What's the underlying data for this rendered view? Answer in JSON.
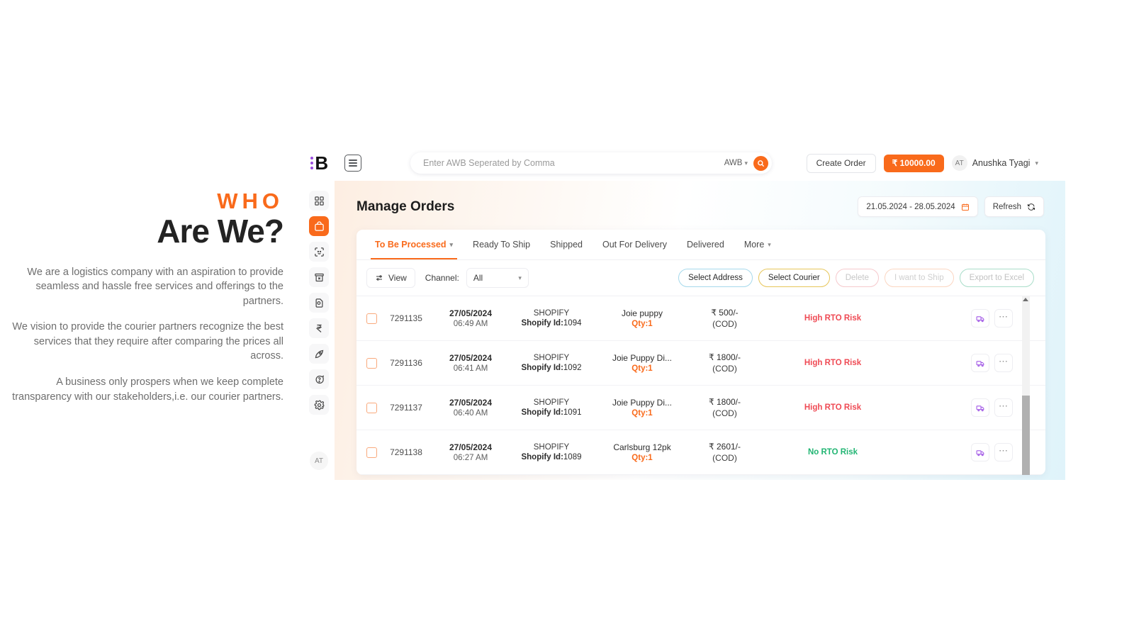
{
  "marketing": {
    "eyebrow": "WHO",
    "heading": "Are We?",
    "paragraphs": [
      "We are a logistics company with an aspiration to provide seamless and hassle free services and offerings to the partners.",
      "We vision to provide the courier partners recognize the best services that they require after comparing the prices all across.",
      "A business only prospers when we keep complete transparency with our stakeholders,i.e. our courier partners."
    ],
    "accent_color": "#f96a1b"
  },
  "topbar": {
    "logo_letter": "B",
    "menu_icon": "hamburger-icon",
    "search": {
      "placeholder": "Enter AWB Seperated by Comma",
      "value": "",
      "filter_label": "AWB",
      "submit_icon": "search-icon"
    },
    "create_order_label": "Create Order",
    "wallet_label": "₹ 10000.00",
    "wallet_color": "#f96a1b",
    "user": {
      "initials": "AT",
      "name": "Anushka Tyagi"
    }
  },
  "sidebar": {
    "items": [
      {
        "name": "dashboard",
        "icon": "grid-icon",
        "active": false
      },
      {
        "name": "orders",
        "icon": "bag-icon",
        "active": true
      },
      {
        "name": "ndr",
        "icon": "face-scan-icon",
        "active": false
      },
      {
        "name": "returns",
        "icon": "archive-box-x-icon",
        "active": false
      },
      {
        "name": "shipments",
        "icon": "document-box-icon",
        "active": false
      },
      {
        "name": "billing",
        "icon": "rupee-icon",
        "active": false
      },
      {
        "name": "tools",
        "icon": "pen-nib-icon",
        "active": false
      },
      {
        "name": "support",
        "icon": "help-chat-icon",
        "active": false
      },
      {
        "name": "settings",
        "icon": "gear-icon",
        "active": false
      }
    ],
    "avatar_initials": "AT"
  },
  "page": {
    "title": "Manage Orders",
    "date_range": "21.05.2024 - 28.05.2024",
    "calendar_icon": "calendar-icon",
    "refresh_label": "Refresh",
    "refresh_icon": "refresh-icon"
  },
  "tabs": [
    {
      "label": "To Be Processed",
      "active": true,
      "has_caret": true
    },
    {
      "label": "Ready To Ship",
      "active": false,
      "has_caret": false
    },
    {
      "label": "Shipped",
      "active": false,
      "has_caret": false
    },
    {
      "label": "Out For Delivery",
      "active": false,
      "has_caret": false
    },
    {
      "label": "Delivered",
      "active": false,
      "has_caret": false
    },
    {
      "label": "More",
      "active": false,
      "has_caret": true
    }
  ],
  "toolbar": {
    "view_label": "View",
    "view_icon": "sliders-icon",
    "channel_label": "Channel:",
    "channel_value": "All",
    "actions": [
      {
        "label": "Select Address",
        "style": "addr",
        "disabled": false,
        "border": "#a6d9ec"
      },
      {
        "label": "Select Courier",
        "style": "courier",
        "disabled": false,
        "border": "#e7c65a"
      },
      {
        "label": "Delete",
        "style": "del",
        "disabled": true,
        "border": "#f6c9cd"
      },
      {
        "label": "I want to Ship",
        "style": "ship",
        "disabled": true,
        "border": "#fbd6c2"
      },
      {
        "label": "Export to Excel",
        "style": "excel",
        "disabled": true,
        "border": "#a9ddc9"
      }
    ]
  },
  "table": {
    "rows": [
      {
        "order_id": "7291135",
        "date": "27/05/2024",
        "time": "06:49 AM",
        "channel": "SHOPIFY",
        "shopify_label": "Shopify Id:",
        "shopify_id": "1094",
        "product": "Joie puppy",
        "qty": "Qty:1",
        "amount": "₹ 500/-",
        "payment": "(COD)",
        "rto": "High RTO Risk",
        "rto_level": "high",
        "ship_icon": "truck-icon",
        "more_icon": "ellipsis-icon"
      },
      {
        "order_id": "7291136",
        "date": "27/05/2024",
        "time": "06:41 AM",
        "channel": "SHOPIFY",
        "shopify_label": "Shopify Id:",
        "shopify_id": "1092",
        "product": "Joie Puppy Di...",
        "qty": "Qty:1",
        "amount": "₹ 1800/-",
        "payment": "(COD)",
        "rto": "High RTO Risk",
        "rto_level": "high",
        "ship_icon": "truck-icon",
        "more_icon": "ellipsis-icon"
      },
      {
        "order_id": "7291137",
        "date": "27/05/2024",
        "time": "06:40 AM",
        "channel": "SHOPIFY",
        "shopify_label": "Shopify Id:",
        "shopify_id": "1091",
        "product": "Joie Puppy Di...",
        "qty": "Qty:1",
        "amount": "₹ 1800/-",
        "payment": "(COD)",
        "rto": "High RTO Risk",
        "rto_level": "high",
        "ship_icon": "truck-icon",
        "more_icon": "ellipsis-icon"
      },
      {
        "order_id": "7291138",
        "date": "27/05/2024",
        "time": "06:27 AM",
        "channel": "SHOPIFY",
        "shopify_label": "Shopify Id:",
        "shopify_id": "1089",
        "product": "Carlsburg 12pk",
        "qty": "Qty:1",
        "amount": "₹ 2601/-",
        "payment": "(COD)",
        "rto": "No RTO Risk",
        "rto_level": "no",
        "ship_icon": "truck-icon",
        "more_icon": "ellipsis-icon"
      }
    ]
  },
  "colors": {
    "accent": "#f96a1b",
    "risk_high": "#ef4a54",
    "risk_none": "#21b573",
    "logo_dots": "#9b4dde"
  }
}
